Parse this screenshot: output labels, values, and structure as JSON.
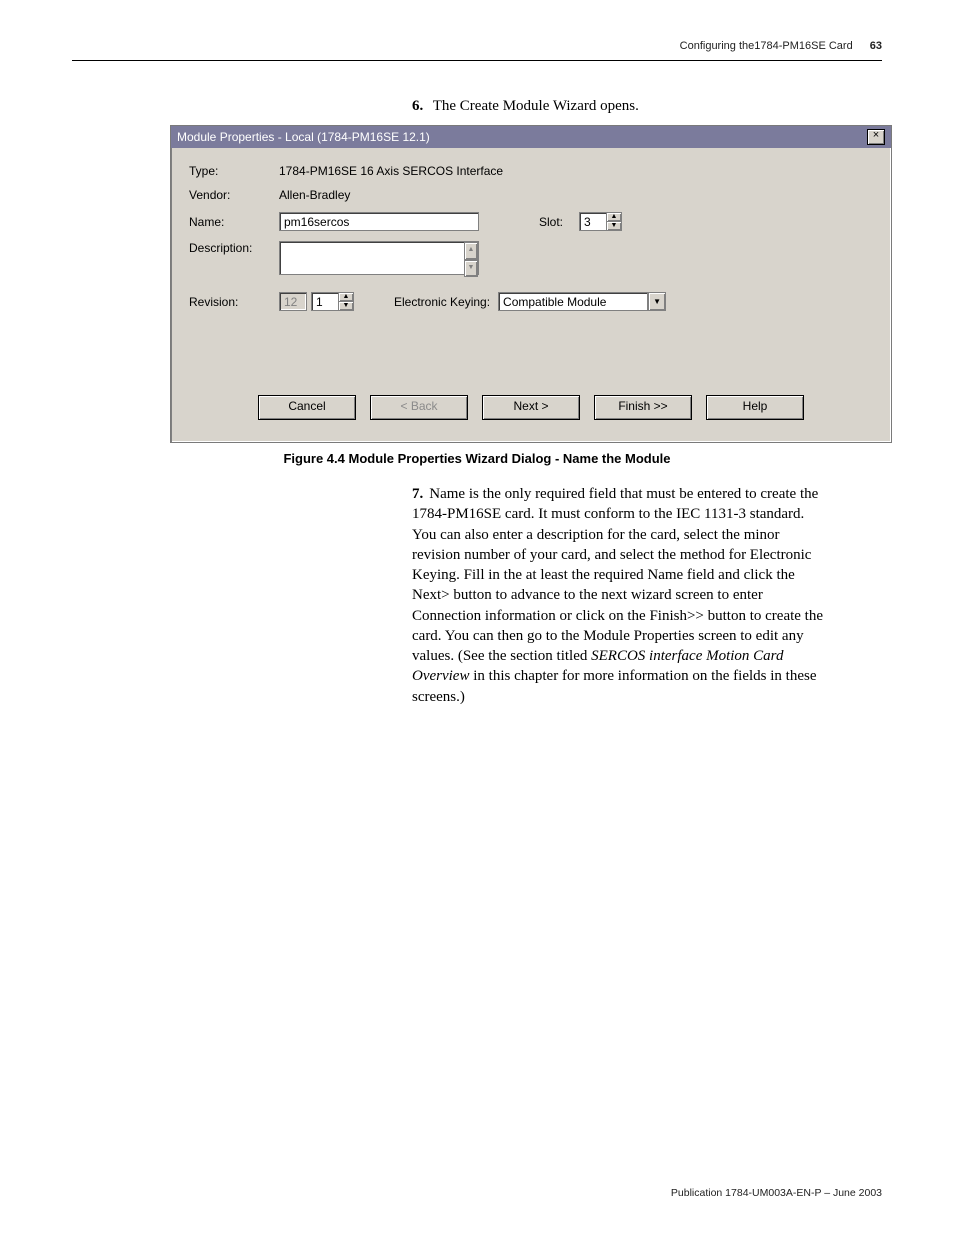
{
  "header": {
    "running": "Configuring the1784-PM16SE Card",
    "pagenum": "63"
  },
  "step6": {
    "number": "6.",
    "text": "The Create Module Wizard opens."
  },
  "dialog": {
    "title": "Module Properties - Local (1784-PM16SE 12.1)",
    "labels": {
      "type": "Type:",
      "vendor": "Vendor:",
      "name": "Name:",
      "description": "Description:",
      "slot": "Slot:",
      "revision": "Revision:",
      "ekeying": "Electronic Keying:"
    },
    "values": {
      "type": "1784-PM16SE 16 Axis SERCOS Interface",
      "vendor": "Allen-Bradley",
      "name": "pm16sercos",
      "description": "",
      "slot": "3",
      "rev_major": "12",
      "rev_minor": "1",
      "ekeying": "Compatible Module"
    },
    "buttons": {
      "cancel": "Cancel",
      "back": "< Back",
      "next": "Next >",
      "finish": "Finish >>",
      "help": "Help"
    }
  },
  "figure_caption": "Figure 4.4 Module Properties Wizard Dialog - Name the Module",
  "step7": {
    "number": "7.",
    "text_a": "Name is the only required field that must be entered to create the 1784-PM16SE card. It must conform to the IEC 1131-3 standard. You can also enter a description for the card, select the minor revision number of your card, and select the method for Electronic Keying. Fill in the at least the required Name field and click the Next> button to advance to the next wizard screen to enter Connection information or click on the Finish>> button to create the card. You can then go to the Module Properties screen to edit any values. (See the section titled ",
    "text_italic": "SERCOS interface Motion Card Overview",
    "text_b": " in this chapter for more information on the fields in these screens.)"
  },
  "footer": "Publication 1784-UM003A-EN-P – June 2003"
}
